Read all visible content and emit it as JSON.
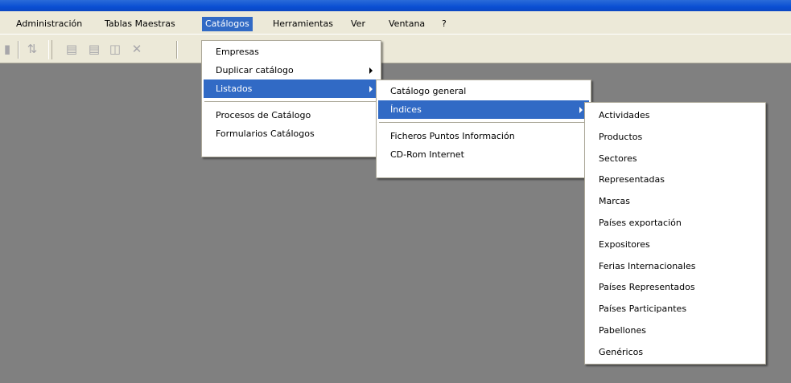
{
  "menubar": {
    "items": [
      "Administración",
      "Tablas Maestras",
      "Catálogos",
      "Herramientas",
      "Ver",
      "Ventana",
      "?"
    ],
    "active": "Catálogos"
  },
  "toolbar": {
    "icons": [
      "print-icon",
      "align-icon",
      "cascade-icon",
      "tile-horizontal-icon",
      "tile-vertical-icon",
      "close-icon"
    ]
  },
  "catalogos_menu": {
    "items": [
      "Empresas",
      "Duplicar catálogo",
      "Listados",
      "Procesos de Catálogo",
      "Formularios Catálogos"
    ],
    "active": "Listados"
  },
  "listados_menu": {
    "items": [
      "Catálogo general",
      "Índices",
      "Ficheros Puntos Información",
      "CD-Rom Internet"
    ],
    "active": "Índices"
  },
  "indices_menu": {
    "items": [
      "Actividades",
      "Productos",
      "Sectores",
      "Representadas",
      "Marcas",
      "Países exportación",
      "Expositores",
      "Ferias Internacionales",
      "Países Representados",
      "Países Participantes",
      "Pabellones",
      "Genéricos"
    ]
  },
  "colors": {
    "highlight": "#316ac5",
    "menu_background": "#ece9d8",
    "workspace": "#808080",
    "title_bar": "#0a4fd3"
  }
}
